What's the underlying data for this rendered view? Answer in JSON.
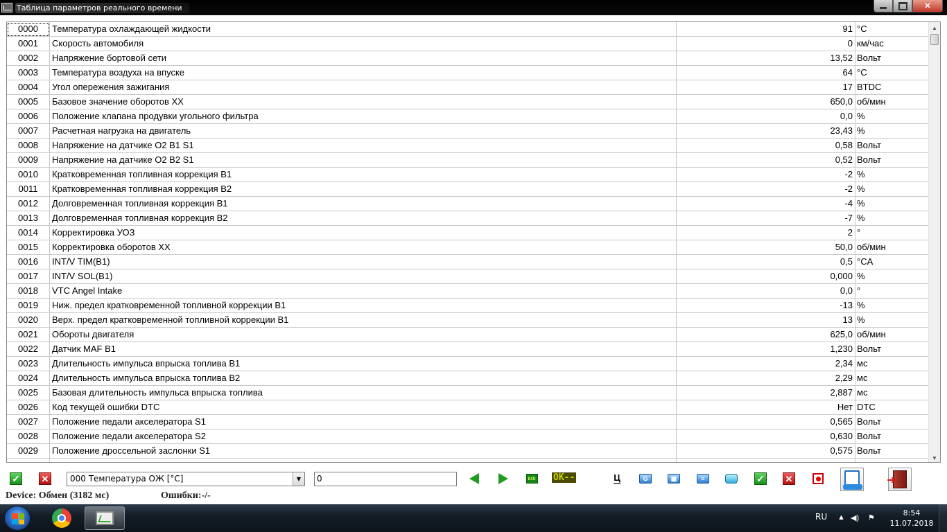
{
  "window": {
    "title": "Таблица параметров реального времени"
  },
  "table": {
    "rows": [
      {
        "id": "0000",
        "name": "Температура охлаждающей жидкости",
        "value": "91",
        "unit": "°C"
      },
      {
        "id": "0001",
        "name": "Скорость автомобиля",
        "value": "0",
        "unit": "км/час"
      },
      {
        "id": "0002",
        "name": "Напряжение бортовой сети",
        "value": "13,52",
        "unit": "Вольт"
      },
      {
        "id": "0003",
        "name": "Температура воздуха на впуске",
        "value": "64",
        "unit": "°C"
      },
      {
        "id": "0004",
        "name": "Угол опережения зажигания",
        "value": "17",
        "unit": "BTDC"
      },
      {
        "id": "0005",
        "name": "Базовое значение оборотов XX",
        "value": "650,0",
        "unit": "об/мин"
      },
      {
        "id": "0006",
        "name": "Положение клапана продувки угольного фильтра",
        "value": "0,0",
        "unit": "%"
      },
      {
        "id": "0007",
        "name": "Расчетная нагрузка на двигатель",
        "value": "23,43",
        "unit": "%"
      },
      {
        "id": "0008",
        "name": "Напряжение на датчике O2 B1 S1",
        "value": "0,58",
        "unit": "Вольт"
      },
      {
        "id": "0009",
        "name": "Напряжение на датчике O2 B2 S1",
        "value": "0,52",
        "unit": "Вольт"
      },
      {
        "id": "0010",
        "name": "Кратковременная топливная коррекция B1",
        "value": "-2",
        "unit": "%"
      },
      {
        "id": "0011",
        "name": "Кратковременная топливная коррекция B2",
        "value": "-2",
        "unit": "%"
      },
      {
        "id": "0012",
        "name": "Долговременная топливная коррекция B1",
        "value": "-4",
        "unit": "%"
      },
      {
        "id": "0013",
        "name": "Долговременная топливная коррекция B2",
        "value": "-7",
        "unit": "%"
      },
      {
        "id": "0014",
        "name": "Корректировка УОЗ",
        "value": "2",
        "unit": "°"
      },
      {
        "id": "0015",
        "name": "Корректировка оборотов XX",
        "value": "50,0",
        "unit": "об/мин"
      },
      {
        "id": "0016",
        "name": "INT/V TIM(B1)",
        "value": "0,5",
        "unit": "°CA"
      },
      {
        "id": "0017",
        "name": "INT/V SOL(B1)",
        "value": "0,000",
        "unit": "%"
      },
      {
        "id": "0018",
        "name": "VTC Angel Intake",
        "value": "0,0",
        "unit": "°"
      },
      {
        "id": "0019",
        "name": "Ниж. предел кратковременной топливной коррекции B1",
        "value": "-13",
        "unit": "%"
      },
      {
        "id": "0020",
        "name": "Верх. предел кратковременной топливной коррекции B1",
        "value": "13",
        "unit": "%"
      },
      {
        "id": "0021",
        "name": "Обороты двигателя",
        "value": "625,0",
        "unit": "об/мин"
      },
      {
        "id": "0022",
        "name": "Датчик MAF B1",
        "value": "1,230",
        "unit": "Вольт"
      },
      {
        "id": "0023",
        "name": "Длительность импульса впрыска топлива B1",
        "value": "2,34",
        "unit": "мс"
      },
      {
        "id": "0024",
        "name": "Длительность импульса впрыска топлива B2",
        "value": "2,29",
        "unit": "мс"
      },
      {
        "id": "0025",
        "name": "Базовая длительность импульса впрыска топлива",
        "value": "2,887",
        "unit": "мс"
      },
      {
        "id": "0026",
        "name": "Код текущей ошибки DTC",
        "value": "Нет",
        "unit": "DTC"
      },
      {
        "id": "0027",
        "name": "Положение педали акселератора S1",
        "value": "0,565",
        "unit": "Вольт"
      },
      {
        "id": "0028",
        "name": "Положение педали акселератора S2",
        "value": "0,630",
        "unit": "Вольт"
      },
      {
        "id": "0029",
        "name": "Положение дроссельной заслонки S1",
        "value": "0,575",
        "unit": "Вольт"
      }
    ]
  },
  "toolbar": {
    "parameter_select": "000 Температура ОЖ [°C]",
    "value_input": "0",
    "ok_label": "OK--",
    "ts_label": "Ц",
    "icons": [
      "check-icon",
      "x-icon",
      "arrow-left-icon",
      "arrow-right-icon",
      "ecu-icon",
      "ts-icon",
      "gauge-icon",
      "table-icon",
      "list-icon",
      "window-icon",
      "check-icon",
      "x-icon",
      "record-icon",
      "report-icon",
      "exit-icon"
    ]
  },
  "status": {
    "device": "Device: Обмен (3182 мс)",
    "errors": "Ошибки:-/-"
  },
  "taskbar": {
    "language": "RU",
    "time": "8:54",
    "date": "11.07.2018"
  }
}
